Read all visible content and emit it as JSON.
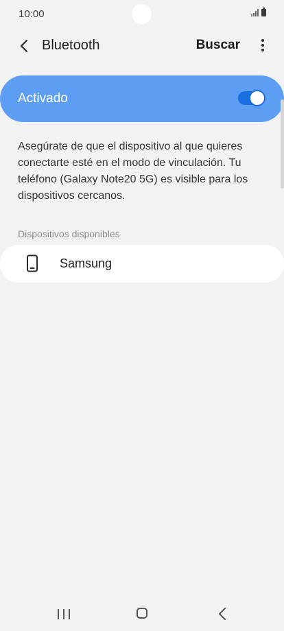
{
  "status_bar": {
    "time": "10:00",
    "icons": [
      "signal-icon",
      "battery-icon"
    ]
  },
  "header": {
    "title": "Bluetooth",
    "back_icon": "chevron-left-icon",
    "search_label": "Buscar",
    "more_icon": "more-vertical-icon"
  },
  "toggle": {
    "label": "Activado",
    "enabled": true,
    "accent_color": "#5e9ef2",
    "switch_color": "#1a6fe0"
  },
  "description": "Asegúrate de que el dispositivo al que quieres conectarte esté en el modo de vinculación. Tu teléfono (Galaxy Note20 5G) es visible para los dispositivos cercanos.",
  "available_devices": {
    "section_label": "Dispositivos disponibles",
    "items": [
      {
        "name": "Samsung",
        "icon": "smartphone-icon"
      }
    ]
  },
  "nav_bar": {
    "icons": [
      "recents-icon",
      "home-icon",
      "back-icon"
    ]
  }
}
